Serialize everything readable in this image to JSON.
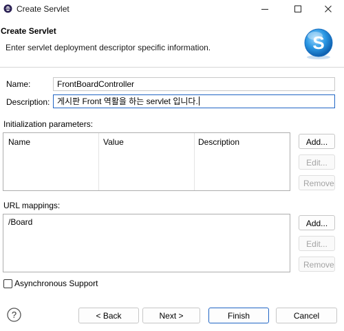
{
  "window": {
    "title": "Create Servlet",
    "minimize_glyph": "─",
    "maximize_glyph": "☐",
    "close_glyph": "✕"
  },
  "banner": {
    "title": "Create Servlet",
    "description": "Enter servlet deployment descriptor specific information.",
    "logo_letter": "S"
  },
  "form": {
    "name_label": "Name:",
    "name_value": "FrontBoardController",
    "description_label": "Description:",
    "description_value": "게시판 Front 역활을 하는 servlet  입니다."
  },
  "init_params": {
    "label": "Initialization parameters:",
    "columns": [
      "Name",
      "Value",
      "Description"
    ],
    "buttons": {
      "add": "Add...",
      "edit": "Edit...",
      "remove": "Remove"
    }
  },
  "url_mappings": {
    "label": "URL mappings:",
    "items": [
      "/Board"
    ],
    "buttons": {
      "add": "Add...",
      "edit": "Edit...",
      "remove": "Remove"
    }
  },
  "async": {
    "label": "Asynchronous Support",
    "checked": false
  },
  "footer": {
    "help_glyph": "?",
    "back": "< Back",
    "next": "Next >",
    "finish": "Finish",
    "cancel": "Cancel"
  }
}
